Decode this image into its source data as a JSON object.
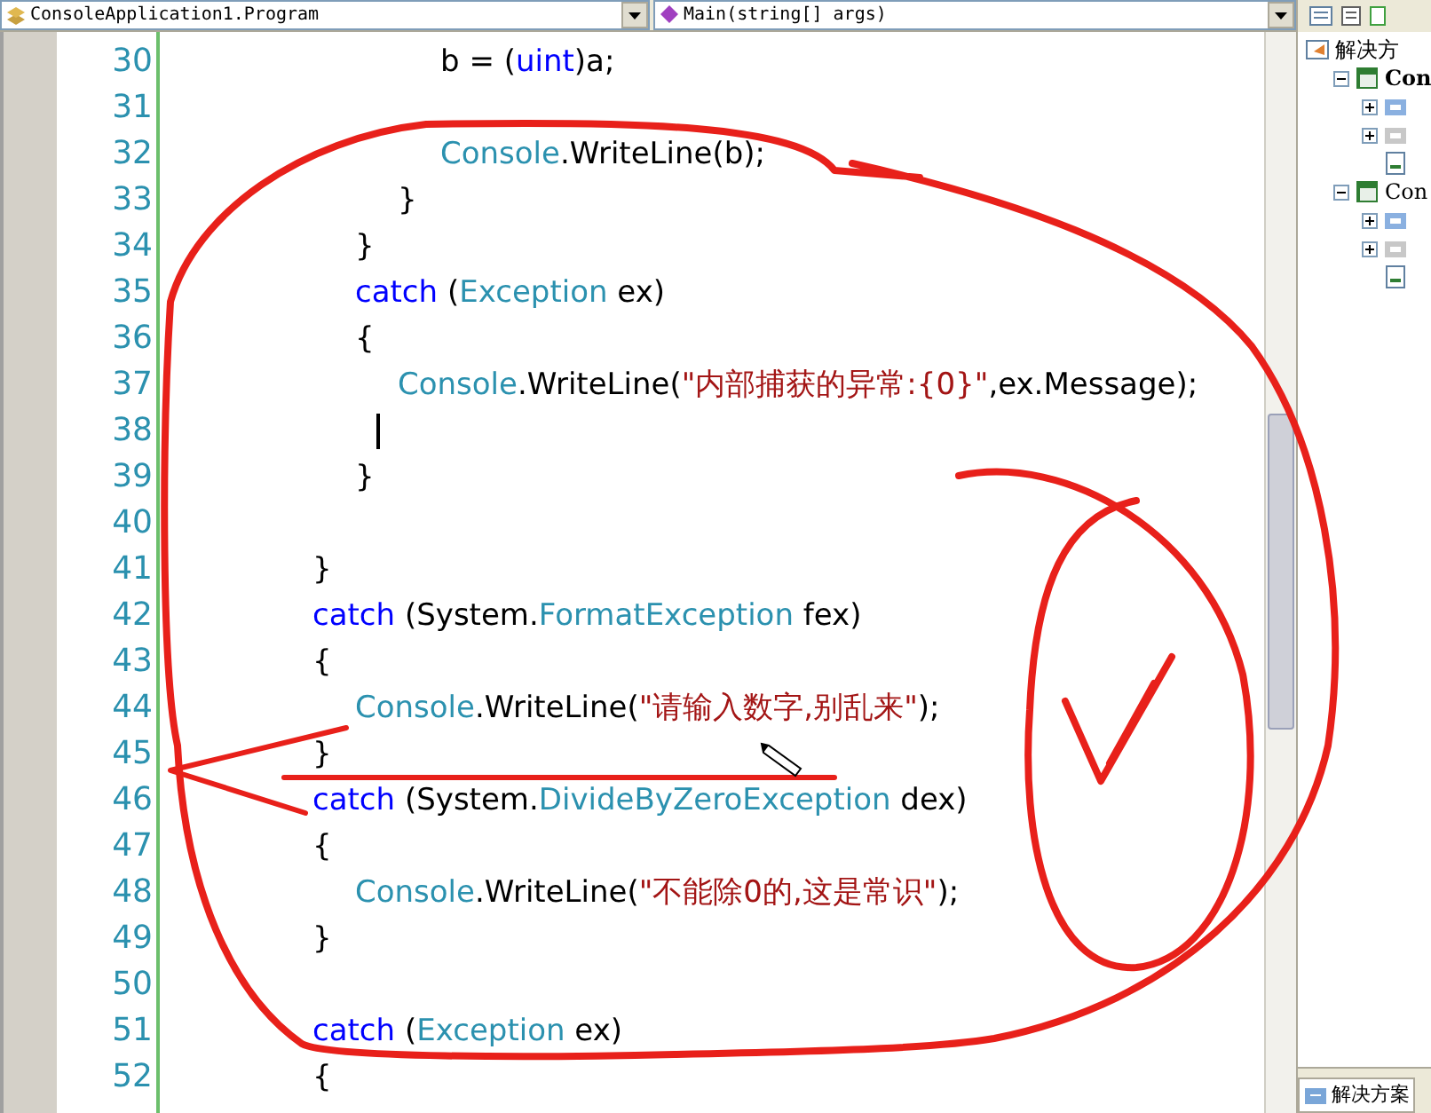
{
  "editor": {
    "class_dropdown": "ConsoleApplication1.Program",
    "member_dropdown": "Main(string[] args)",
    "lines": [
      {
        "number": "30",
        "tokens": [
          {
            "kind": "plain",
            "text": "\t\t\t\t\t\tb = ("
          },
          {
            "kind": "keyword",
            "text": "uint"
          },
          {
            "kind": "plain",
            "text": ")a;"
          }
        ]
      },
      {
        "number": "31"
      },
      {
        "number": "32",
        "tokens": [
          {
            "kind": "type",
            "text": "\t\t\t\t\t\tConsole"
          },
          {
            "kind": "plain",
            "text": ".WriteLine(b);"
          }
        ]
      },
      {
        "number": "33",
        "tokens": [
          {
            "kind": "plain",
            "text": "\t\t\t\t\t}"
          }
        ]
      },
      {
        "number": "34",
        "tokens": [
          {
            "kind": "plain",
            "text": "\t\t\t\t}"
          }
        ]
      },
      {
        "number": "35",
        "tokens": [
          {
            "kind": "keyword",
            "text": "\t\t\t\tcatch"
          },
          {
            "kind": "plain",
            "text": " ("
          },
          {
            "kind": "type",
            "text": "Exception"
          },
          {
            "kind": "plain",
            "text": " ex)"
          }
        ]
      },
      {
        "number": "36",
        "tokens": [
          {
            "kind": "plain",
            "text": "\t\t\t\t{"
          }
        ]
      },
      {
        "number": "37",
        "tokens": [
          {
            "kind": "type",
            "text": "\t\t\t\t\tConsole"
          },
          {
            "kind": "plain",
            "text": ".WriteLine("
          },
          {
            "kind": "string",
            "text": "\"内部捕获的异常:{0}\""
          },
          {
            "kind": "plain",
            "text": ",ex.Message);"
          }
        ]
      },
      {
        "number": "38",
        "cursor": true
      },
      {
        "number": "39",
        "tokens": [
          {
            "kind": "plain",
            "text": "\t\t\t\t}"
          }
        ]
      },
      {
        "number": "40"
      },
      {
        "number": "41",
        "tokens": [
          {
            "kind": "plain",
            "text": "\t\t\t}"
          }
        ]
      },
      {
        "number": "42",
        "tokens": [
          {
            "kind": "keyword",
            "text": "\t\t\tcatch"
          },
          {
            "kind": "plain",
            "text": " (System."
          },
          {
            "kind": "type",
            "text": "FormatException"
          },
          {
            "kind": "plain",
            "text": " fex)"
          }
        ]
      },
      {
        "number": "43",
        "tokens": [
          {
            "kind": "plain",
            "text": "\t\t\t{"
          }
        ]
      },
      {
        "number": "44",
        "tokens": [
          {
            "kind": "type",
            "text": "\t\t\t\tConsole"
          },
          {
            "kind": "plain",
            "text": ".WriteLine("
          },
          {
            "kind": "string",
            "text": "\"请输入数字,别乱来\""
          },
          {
            "kind": "plain",
            "text": ");"
          }
        ]
      },
      {
        "number": "45",
        "tokens": [
          {
            "kind": "plain",
            "text": "\t\t\t}"
          }
        ]
      },
      {
        "number": "46",
        "tokens": [
          {
            "kind": "keyword",
            "text": "\t\t\tcatch"
          },
          {
            "kind": "plain",
            "text": " (System."
          },
          {
            "kind": "type",
            "text": "DivideByZeroException"
          },
          {
            "kind": "plain",
            "text": " dex)"
          }
        ]
      },
      {
        "number": "47",
        "tokens": [
          {
            "kind": "plain",
            "text": "\t\t\t{"
          }
        ]
      },
      {
        "number": "48",
        "tokens": [
          {
            "kind": "type",
            "text": "\t\t\t\tConsole"
          },
          {
            "kind": "plain",
            "text": ".WriteLine("
          },
          {
            "kind": "string",
            "text": "\"不能除0的,这是常识\""
          },
          {
            "kind": "plain",
            "text": ");"
          }
        ]
      },
      {
        "number": "49",
        "tokens": [
          {
            "kind": "plain",
            "text": "\t\t\t}"
          }
        ]
      },
      {
        "number": "50"
      },
      {
        "number": "51",
        "tokens": [
          {
            "kind": "keyword",
            "text": "\t\t\tcatch"
          },
          {
            "kind": "plain",
            "text": " ("
          },
          {
            "kind": "type",
            "text": "Exception"
          },
          {
            "kind": "plain",
            "text": " ex)"
          }
        ]
      },
      {
        "number": "52",
        "tokens": [
          {
            "kind": "plain",
            "text": "\t\t\t{"
          }
        ]
      }
    ]
  },
  "solution_explorer": {
    "tree": [
      {
        "kind": "solution",
        "label": "解决方",
        "children": [
          {
            "kind": "project",
            "label": "Con",
            "startup": true,
            "expanded": true,
            "children": [
              {
                "kind": "properties",
                "expanded": false
              },
              {
                "kind": "references",
                "expanded": false
              },
              {
                "kind": "file"
              }
            ]
          },
          {
            "kind": "project",
            "label": "Con",
            "startup": false,
            "expanded": true,
            "children": [
              {
                "kind": "properties",
                "expanded": false
              },
              {
                "kind": "references",
                "expanded": false
              },
              {
                "kind": "file"
              }
            ]
          }
        ]
      }
    ],
    "bottom_tab": "解决方案"
  }
}
